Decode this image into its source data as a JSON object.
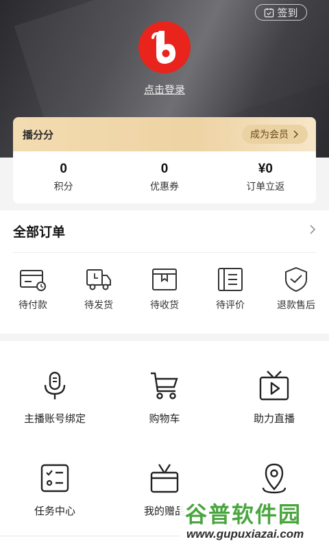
{
  "header": {
    "checkin_label": "签到",
    "login_label": "点击登录",
    "logo_color": "#e8241c"
  },
  "member": {
    "title": "播分分",
    "button_label": "成为会员"
  },
  "stats": [
    {
      "value": "0",
      "label": "积分"
    },
    {
      "value": "0",
      "label": "优惠券"
    },
    {
      "value": "¥0",
      "label": "订单立返"
    }
  ],
  "orders": {
    "title": "全部订单",
    "items": [
      {
        "label": "待付款",
        "icon": "card-clock-icon"
      },
      {
        "label": "待发货",
        "icon": "truck-icon"
      },
      {
        "label": "待收货",
        "icon": "box-icon"
      },
      {
        "label": "待评价",
        "icon": "review-icon"
      },
      {
        "label": "退款售后",
        "icon": "shield-check-icon"
      }
    ]
  },
  "services": [
    {
      "label": "主播账号绑定",
      "icon": "microphone-icon"
    },
    {
      "label": "购物车",
      "icon": "cart-icon"
    },
    {
      "label": "助力直播",
      "icon": "live-tv-icon"
    },
    {
      "label": "任务中心",
      "icon": "task-list-icon"
    },
    {
      "label": "我的赠品",
      "icon": "gift-icon"
    },
    {
      "label": "",
      "icon": "location-pin-icon"
    }
  ],
  "watermark": {
    "title": "谷普软件园",
    "url": "www.gupuxiazai.com"
  },
  "colors": {
    "accent_red": "#e8241c",
    "member_gold": "#eed3a3",
    "watermark_green": "#49a63e"
  }
}
